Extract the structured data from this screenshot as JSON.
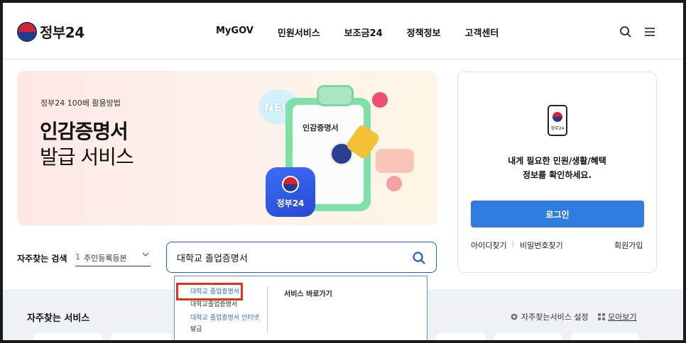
{
  "header": {
    "logo_text": "정부24",
    "nav": [
      "MyGOV",
      "민원서비스",
      "보조금24",
      "정책정보",
      "고객센터"
    ]
  },
  "banner": {
    "subtitle": "정부24 100배 활용방법",
    "title_line1": "인감증명서",
    "title_line2": "발급 서비스",
    "new_badge": "NEW",
    "paper_title": "인감증명서",
    "app_label": "정부24"
  },
  "login": {
    "phone_label": "정부24",
    "message_line1": "내게 필요한 민원/생활/혜택",
    "message_line2": "정보를 확인하세요.",
    "button": "로그인",
    "find_id": "아이디찾기",
    "find_pw": "비밀번호찾기",
    "signup": "회원가입"
  },
  "search": {
    "fav_label": "자주찾는 검색",
    "fav_rank": "1",
    "fav_value": "주민등록등본",
    "query": "대학교 졸업증명서"
  },
  "autocomplete": {
    "items": [
      "대학교 졸업증명서",
      "대학교졸업증명서",
      "대학교 졸업증명서 인터넷",
      "발급"
    ],
    "shortcut_title": "서비스 바로가기"
  },
  "services": {
    "title": "자주찾는 서비스",
    "settings": "자주찾는서비스 설정",
    "view_all": "모아보기"
  },
  "colors": {
    "primary": "#2f7de1",
    "accent_red": "#e0321e",
    "link_blue": "#2f6fd8"
  }
}
